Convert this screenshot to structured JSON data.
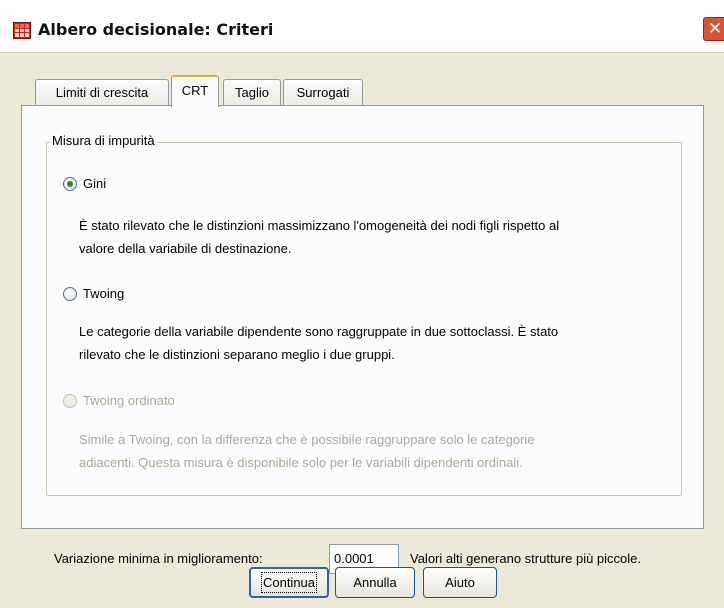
{
  "window": {
    "title": "Albero decisionale: Criteri",
    "close_glyph": "✕"
  },
  "tabs": [
    {
      "label": "Limiti di crescita"
    },
    {
      "label": "CRT",
      "active": true
    },
    {
      "label": "Taglio"
    },
    {
      "label": "Surrogati"
    }
  ],
  "impurity": {
    "legend": "Misura di impurità",
    "options": [
      {
        "label": "Gini",
        "checked": true,
        "enabled": true,
        "desc_lines": [
          "È stato rilevato che le distinzioni massimizzano l'omogeneità dei nodi figli rispetto al",
          "valore della variabile di destinazione."
        ]
      },
      {
        "label": "Twoing",
        "checked": false,
        "enabled": true,
        "desc_lines": [
          "Le categorie della variabile dipendente sono raggruppate in due sottoclassi. È stato",
          "rilevato che le distinzioni separano meglio i due gruppi."
        ]
      },
      {
        "label": "Twoing ordinato",
        "checked": false,
        "enabled": false,
        "desc_lines": [
          "Simile a Twoing, con la differenza che è possibile raggruppare solo le categorie",
          "adiacenti. Questa misura è disponibile solo per le variabili dipendenti ordinali."
        ]
      }
    ]
  },
  "min_change": {
    "label": "Variazione minima in miglioramento:",
    "value": "0.0001",
    "hint": "Valori alti generano strutture più piccole."
  },
  "buttons": {
    "continue": "Continua",
    "cancel": "Annulla",
    "help": "Aiuto"
  },
  "colors": {
    "dialog_bg": "#ece9d8",
    "tab_active_accent": "#e7a83a",
    "close_button": "#d8553a",
    "radio_checked": "#2f8a2a",
    "disabled_text": "#aca899"
  }
}
